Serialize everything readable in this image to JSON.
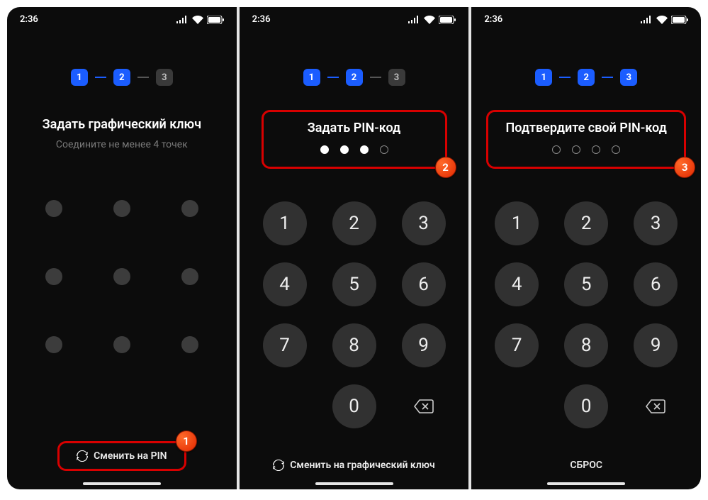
{
  "status": {
    "time": "2:36"
  },
  "steps": {
    "labels": [
      "1",
      "2",
      "3"
    ]
  },
  "screens": [
    {
      "stepper_active": [
        true,
        true,
        false
      ],
      "title": "Задать графический ключ",
      "subtitle": "Соедините не менее 4 точек",
      "switch_label": "Сменить на PIN",
      "badge": "1"
    },
    {
      "stepper_active": [
        true,
        true,
        false
      ],
      "title": "Задать PIN-код",
      "pin_filled": [
        true,
        true,
        true,
        false
      ],
      "switch_label": "Сменить на графический ключ",
      "badge": "2",
      "keys": [
        "1",
        "2",
        "3",
        "4",
        "5",
        "6",
        "7",
        "8",
        "9",
        "",
        "0",
        "⌫"
      ]
    },
    {
      "stepper_active": [
        true,
        true,
        true
      ],
      "title": "Подтвердите свой PIN-код",
      "pin_filled": [
        false,
        false,
        false,
        false
      ],
      "reset_label": "СБРОС",
      "badge": "3",
      "keys": [
        "1",
        "2",
        "3",
        "4",
        "5",
        "6",
        "7",
        "8",
        "9",
        "",
        "0",
        "⌫"
      ]
    }
  ]
}
